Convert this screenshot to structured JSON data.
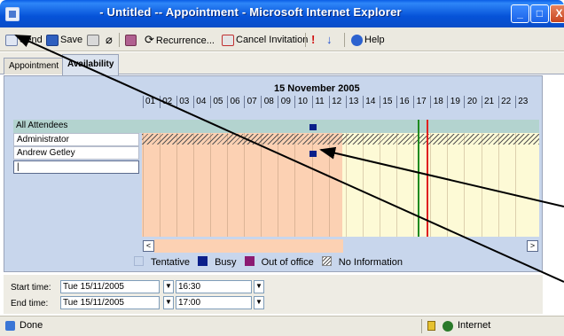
{
  "window": {
    "title": "- Untitled -- Appointment - Microsoft Internet Explorer",
    "minimize": "_",
    "maximize": "□",
    "close": "X"
  },
  "toolbar": {
    "send": "Send",
    "save": "Save",
    "recurrence": "Recurrence...",
    "cancel_invitation": "Cancel Invitation",
    "help": "Help"
  },
  "tabs": [
    {
      "label": "Appointment",
      "active": false
    },
    {
      "label": "Availability",
      "active": true
    }
  ],
  "schedule": {
    "date": "15 November 2005",
    "hours": [
      "01",
      "02",
      "03",
      "04",
      "05",
      "06",
      "07",
      "08",
      "09",
      "10",
      "11",
      "12",
      "13",
      "14",
      "15",
      "16",
      "17",
      "18",
      "19",
      "20",
      "21",
      "22",
      "23"
    ],
    "all_attendees_label": "All Attendees",
    "attendees": [
      "Administrator",
      "Andrew Getley",
      ""
    ],
    "scroll_left": "<",
    "scroll_right": ">"
  },
  "legend": {
    "tentative": "Tentative",
    "busy": "Busy",
    "out_of_office": "Out of office",
    "no_information": "No Information"
  },
  "times": {
    "start_label": "Start time:",
    "start_date": "Tue 15/11/2005",
    "start_time": "16:30",
    "end_label": "End time:",
    "end_date": "Tue 15/11/2005",
    "end_time": "17:00"
  },
  "status": {
    "text": "Done",
    "zone": "Internet"
  },
  "colors": {
    "tentative": "#c8d6ec",
    "busy": "#0b1f8a",
    "out_of_office": "#8b1a72",
    "working_hours": "#fcd1b3",
    "off_hours": "#fdfad6"
  }
}
